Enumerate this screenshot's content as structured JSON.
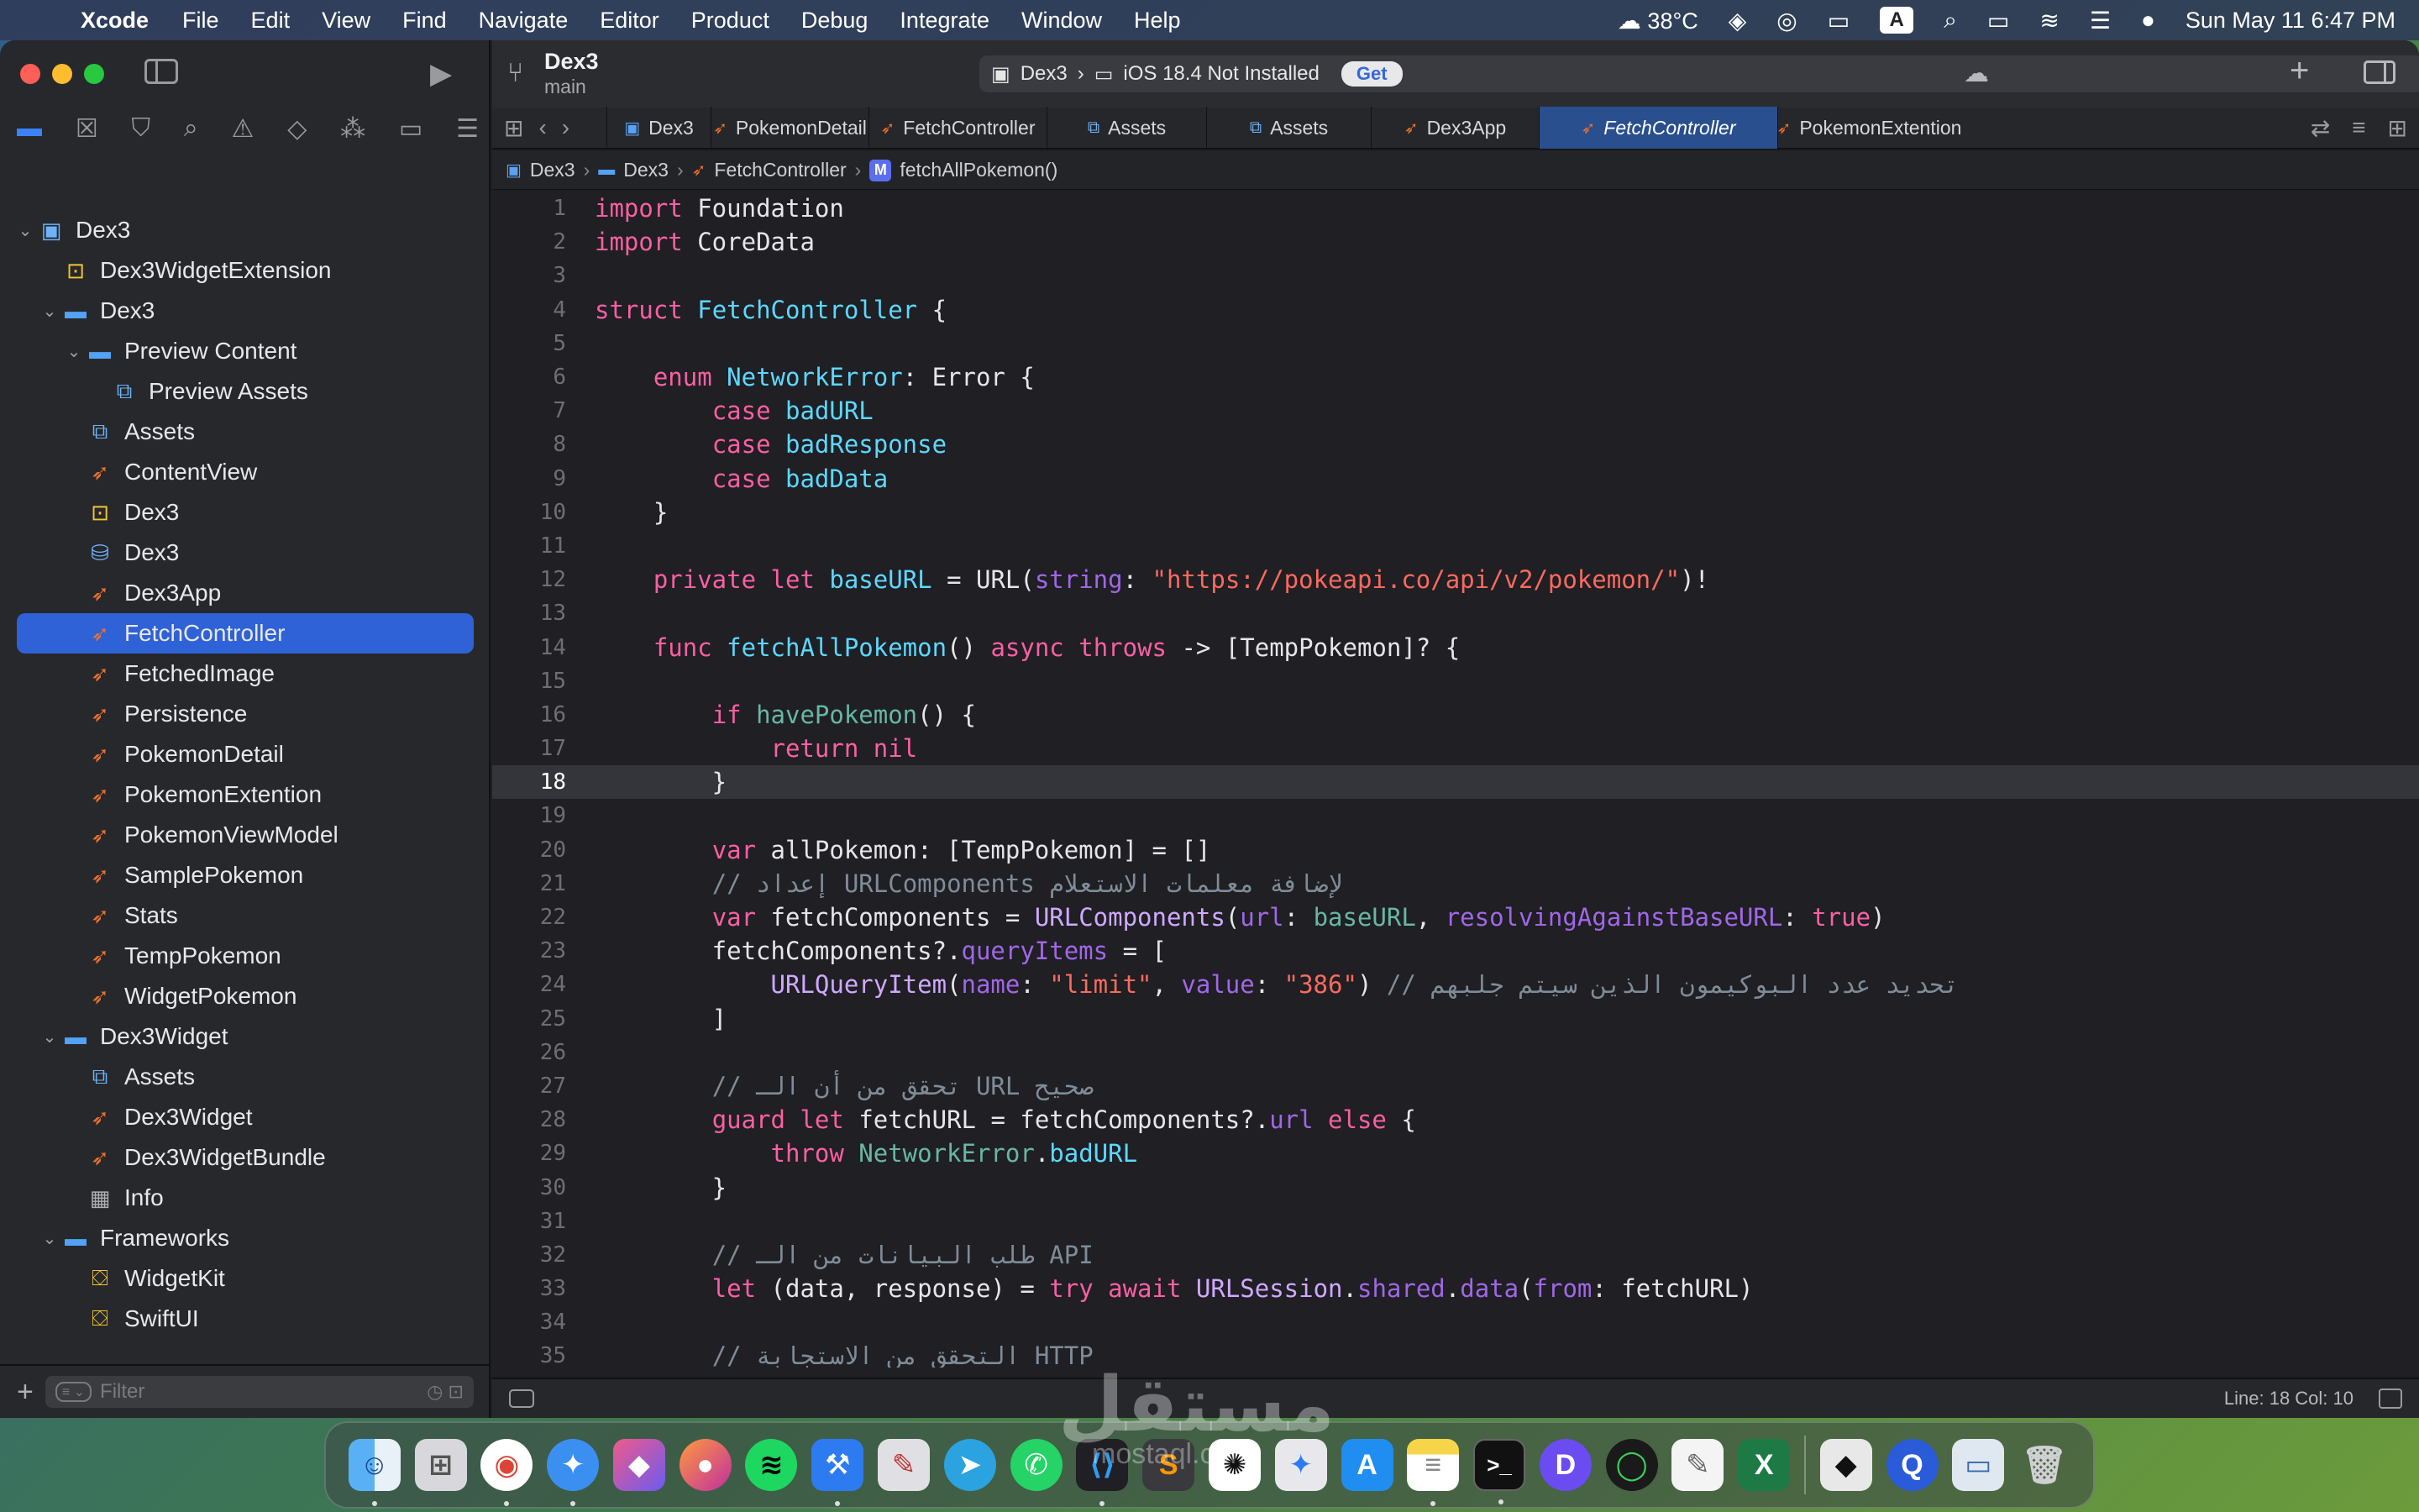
{
  "menubar": {
    "app_name": "Xcode",
    "items": [
      "File",
      "Edit",
      "View",
      "Find",
      "Navigate",
      "Editor",
      "Product",
      "Debug",
      "Integrate",
      "Window",
      "Help"
    ],
    "weather": "38°C",
    "input_source": "A",
    "datetime": "Sun May 11  6:47 PM"
  },
  "toolbar": {
    "project_title": "Dex3",
    "branch": "main",
    "scheme": "Dex3",
    "destination": "iOS 18.4 Not Installed",
    "get_label": "Get"
  },
  "sidebar": {
    "filter_placeholder": "Filter",
    "tree": [
      {
        "label": "Dex3",
        "icon": "project-icon",
        "depth": 0,
        "expanded": true
      },
      {
        "label": "Dex3WidgetExtension",
        "icon": "extension-icon",
        "depth": 1
      },
      {
        "label": "Dex3",
        "icon": "folder-icon",
        "depth": 1,
        "expanded": true
      },
      {
        "label": "Preview Content",
        "icon": "folder-icon",
        "depth": 2,
        "expanded": true
      },
      {
        "label": "Preview Assets",
        "icon": "assets-icon",
        "depth": 3
      },
      {
        "label": "Assets",
        "icon": "assets-icon",
        "depth": 2
      },
      {
        "label": "ContentView",
        "icon": "swift-icon",
        "depth": 2
      },
      {
        "label": "Dex3",
        "icon": "extension-icon",
        "depth": 2
      },
      {
        "label": "Dex3",
        "icon": "coredata-icon",
        "depth": 2
      },
      {
        "label": "Dex3App",
        "icon": "swift-icon",
        "depth": 2
      },
      {
        "label": "FetchController",
        "icon": "swift-icon",
        "depth": 2,
        "selected": true
      },
      {
        "label": "FetchedImage",
        "icon": "swift-icon",
        "depth": 2
      },
      {
        "label": "Persistence",
        "icon": "swift-icon",
        "depth": 2
      },
      {
        "label": "PokemonDetail",
        "icon": "swift-icon",
        "depth": 2
      },
      {
        "label": "PokemonExtention",
        "icon": "swift-icon",
        "depth": 2
      },
      {
        "label": "PokemonViewModel",
        "icon": "swift-icon",
        "depth": 2
      },
      {
        "label": "SamplePokemon",
        "icon": "swift-icon",
        "depth": 2
      },
      {
        "label": "Stats",
        "icon": "swift-icon",
        "depth": 2
      },
      {
        "label": "TempPokemon",
        "icon": "swift-icon",
        "depth": 2
      },
      {
        "label": "WidgetPokemon",
        "icon": "swift-icon",
        "depth": 2
      },
      {
        "label": "Dex3Widget",
        "icon": "folder-icon",
        "depth": 1,
        "expanded": true
      },
      {
        "label": "Assets",
        "icon": "assets-icon",
        "depth": 2
      },
      {
        "label": "Dex3Widget",
        "icon": "swift-icon",
        "depth": 2
      },
      {
        "label": "Dex3WidgetBundle",
        "icon": "swift-icon",
        "depth": 2
      },
      {
        "label": "Info",
        "icon": "table-icon",
        "depth": 2
      },
      {
        "label": "Frameworks",
        "icon": "folder-icon",
        "depth": 1,
        "expanded": true
      },
      {
        "label": "WidgetKit",
        "icon": "toolbox-icon",
        "depth": 2
      },
      {
        "label": "SwiftUI",
        "icon": "toolbox-icon",
        "depth": 2
      }
    ]
  },
  "tabs": [
    {
      "label": "Dex3",
      "icon": "project-icon"
    },
    {
      "label": "PokemonDetail",
      "icon": "swift-icon"
    },
    {
      "label": "FetchController",
      "icon": "swift-icon"
    },
    {
      "label": "Assets",
      "icon": "assets-icon"
    },
    {
      "label": "Assets",
      "icon": "assets-icon"
    },
    {
      "label": "Dex3App",
      "icon": "swift-icon"
    },
    {
      "label": "FetchController",
      "icon": "swift-icon",
      "active": true
    },
    {
      "label": "PokemonExtention",
      "icon": "swift-icon"
    }
  ],
  "breadcrumb": [
    "Dex3",
    "Dex3",
    "FetchController",
    "fetchAllPokemon()"
  ],
  "editor": {
    "current_line": 18,
    "lines": [
      [
        [
          "kw",
          "import"
        ],
        [
          "pl",
          " Foundation"
        ]
      ],
      [
        [
          "kw",
          "import"
        ],
        [
          "pl",
          " CoreData"
        ]
      ],
      [],
      [
        [
          "kw",
          "struct"
        ],
        [
          "pl",
          " "
        ],
        [
          "ty",
          "FetchController"
        ],
        [
          "pl",
          " {"
        ]
      ],
      [],
      [
        [
          "pl",
          "    "
        ],
        [
          "kw",
          "enum"
        ],
        [
          "pl",
          " "
        ],
        [
          "ty",
          "NetworkError"
        ],
        [
          "pl",
          ": Error {"
        ]
      ],
      [
        [
          "pl",
          "        "
        ],
        [
          "kw",
          "case"
        ],
        [
          "pl",
          " "
        ],
        [
          "idn",
          "badURL"
        ]
      ],
      [
        [
          "pl",
          "        "
        ],
        [
          "kw",
          "case"
        ],
        [
          "pl",
          " "
        ],
        [
          "idn",
          "badResponse"
        ]
      ],
      [
        [
          "pl",
          "        "
        ],
        [
          "kw",
          "case"
        ],
        [
          "pl",
          " "
        ],
        [
          "idn",
          "badData"
        ]
      ],
      [
        [
          "pl",
          "    }"
        ]
      ],
      [],
      [
        [
          "pl",
          "    "
        ],
        [
          "kw",
          "private"
        ],
        [
          "pl",
          " "
        ],
        [
          "kw",
          "let"
        ],
        [
          "pl",
          " "
        ],
        [
          "idn",
          "baseURL"
        ],
        [
          "pl",
          " = URL("
        ],
        [
          "prm",
          "string"
        ],
        [
          "pl",
          ": "
        ],
        [
          "str",
          "\"https://pokeapi.co/api/v2/pokemon/\""
        ],
        [
          "pl",
          ")!"
        ]
      ],
      [],
      [
        [
          "pl",
          "    "
        ],
        [
          "kw",
          "func"
        ],
        [
          "pl",
          " "
        ],
        [
          "idn",
          "fetchAllPokemon"
        ],
        [
          "pl",
          "() "
        ],
        [
          "kw",
          "async"
        ],
        [
          "pl",
          " "
        ],
        [
          "kw",
          "throws"
        ],
        [
          "pl",
          " -> [TempPokemon]? {"
        ]
      ],
      [],
      [
        [
          "pl",
          "        "
        ],
        [
          "kw",
          "if"
        ],
        [
          "pl",
          " "
        ],
        [
          "fn",
          "havePokemon"
        ],
        [
          "pl",
          "() {"
        ]
      ],
      [
        [
          "pl",
          "            "
        ],
        [
          "kw",
          "return"
        ],
        [
          "pl",
          " "
        ],
        [
          "kw",
          "nil"
        ]
      ],
      [
        [
          "pl",
          "        }"
        ]
      ],
      [],
      [
        [
          "pl",
          "        "
        ],
        [
          "kw",
          "var"
        ],
        [
          "pl",
          " allPokemon: [TempPokemon] = []"
        ]
      ],
      [
        [
          "pl",
          "        "
        ],
        [
          "cm",
          "// إعداد URLComponents لإضافة معلمات الاستعلام"
        ]
      ],
      [
        [
          "pl",
          "        "
        ],
        [
          "kw",
          "var"
        ],
        [
          "pl",
          " fetchComponents = "
        ],
        [
          "ty2",
          "URLComponents"
        ],
        [
          "pl",
          "("
        ],
        [
          "prm",
          "url"
        ],
        [
          "pl",
          ": "
        ],
        [
          "fn",
          "baseURL"
        ],
        [
          "pl",
          ", "
        ],
        [
          "prm",
          "resolvingAgainstBaseURL"
        ],
        [
          "pl",
          ": "
        ],
        [
          "kw",
          "true"
        ],
        [
          "pl",
          ")"
        ]
      ],
      [
        [
          "pl",
          "        fetchComponents?."
        ],
        [
          "mem",
          "queryItems"
        ],
        [
          "pl",
          " = ["
        ]
      ],
      [
        [
          "pl",
          "            "
        ],
        [
          "ty2",
          "URLQueryItem"
        ],
        [
          "pl",
          "("
        ],
        [
          "prm",
          "name"
        ],
        [
          "pl",
          ": "
        ],
        [
          "str",
          "\"limit\""
        ],
        [
          "pl",
          ", "
        ],
        [
          "prm",
          "value"
        ],
        [
          "pl",
          ": "
        ],
        [
          "str",
          "\"386\""
        ],
        [
          "pl",
          ") "
        ],
        [
          "cm",
          "// تحديد عدد البوكيمون الذين سيتم جلبهم"
        ]
      ],
      [
        [
          "pl",
          "        ]"
        ]
      ],
      [],
      [
        [
          "pl",
          "        "
        ],
        [
          "cm",
          "// تحقق من أن الـ URL صحيح"
        ]
      ],
      [
        [
          "pl",
          "        "
        ],
        [
          "kw",
          "guard"
        ],
        [
          "pl",
          " "
        ],
        [
          "kw",
          "let"
        ],
        [
          "pl",
          " fetchURL = fetchComponents?."
        ],
        [
          "mem",
          "url"
        ],
        [
          "pl",
          " "
        ],
        [
          "kw",
          "else"
        ],
        [
          "pl",
          " {"
        ]
      ],
      [
        [
          "pl",
          "            "
        ],
        [
          "kw",
          "throw"
        ],
        [
          "pl",
          " "
        ],
        [
          "fn",
          "NetworkError"
        ],
        [
          "pl",
          "."
        ],
        [
          "idn",
          "badURL"
        ]
      ],
      [
        [
          "pl",
          "        }"
        ]
      ],
      [],
      [
        [
          "pl",
          "        "
        ],
        [
          "cm",
          "// طلب البيانات من الـ API"
        ]
      ],
      [
        [
          "pl",
          "        "
        ],
        [
          "kw",
          "let"
        ],
        [
          "pl",
          " (data, response) = "
        ],
        [
          "kw",
          "try"
        ],
        [
          "pl",
          " "
        ],
        [
          "kw",
          "await"
        ],
        [
          "pl",
          " "
        ],
        [
          "ty2",
          "URLSession"
        ],
        [
          "pl",
          "."
        ],
        [
          "mem",
          "shared"
        ],
        [
          "pl",
          "."
        ],
        [
          "mem",
          "data"
        ],
        [
          "pl",
          "("
        ],
        [
          "prm",
          "from"
        ],
        [
          "pl",
          ": fetchURL)"
        ]
      ],
      [],
      [
        [
          "pl",
          "        "
        ],
        [
          "cm",
          "// التحقق من الاستجابة HTTP"
        ]
      ]
    ]
  },
  "statusbar": {
    "position": "Line: 18  Col: 10"
  },
  "watermark": {
    "text": "مستقل",
    "sub": "mostaql.com"
  },
  "colors": {
    "selection": "#2f62d6",
    "keyword": "#fc5fa3",
    "string": "#fc6a5d",
    "type": "#5dd8ff",
    "comment": "#7f8c98"
  }
}
